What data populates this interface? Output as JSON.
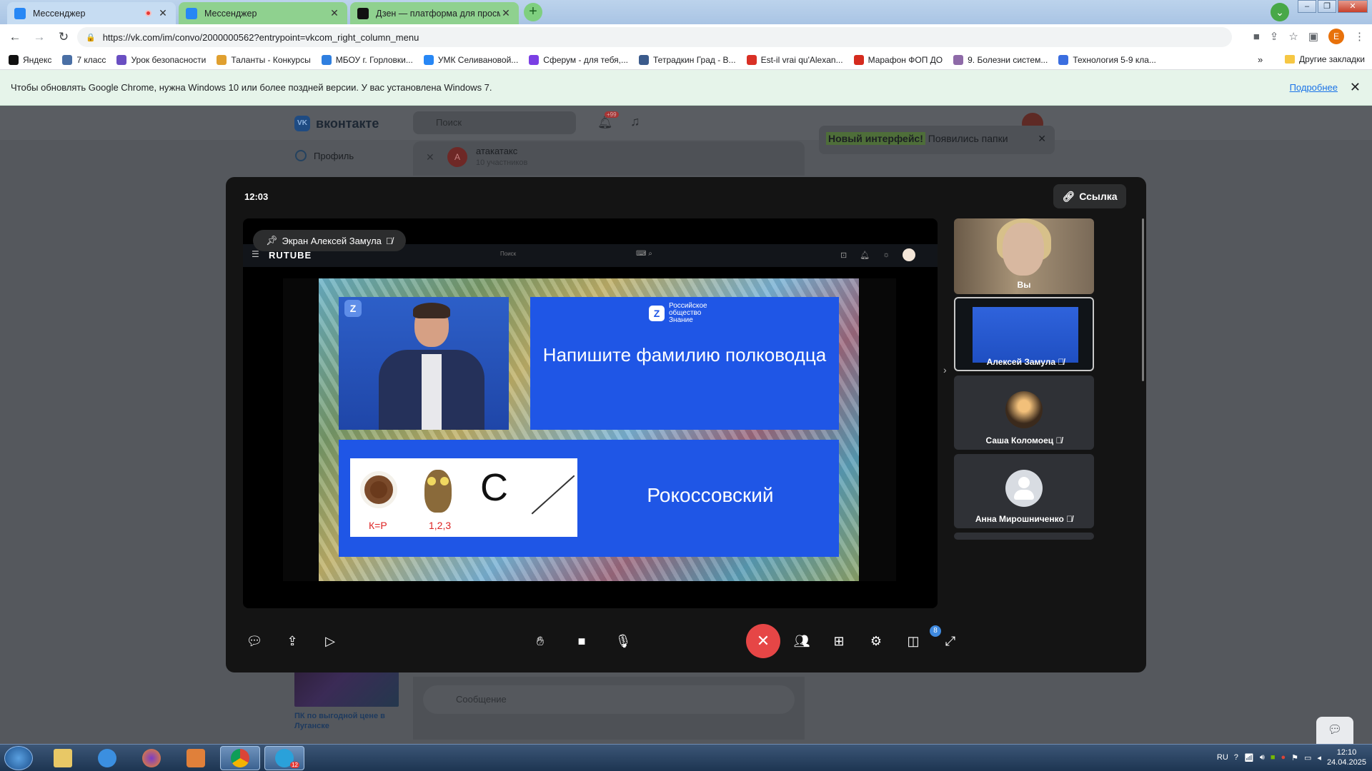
{
  "browser": {
    "tabs": [
      {
        "title": "Мессенджер",
        "recording": true,
        "favicon_color": "#2787f5"
      },
      {
        "title": "Мессенджер",
        "recording": false,
        "favicon_color": "#2787f5"
      },
      {
        "title": "Дзен — платформа для просмо",
        "recording": false,
        "favicon_color": "#111111"
      }
    ],
    "url": "https://vk.com/im/convo/2000000562?entrypoint=vkcom_right_column_menu",
    "profile_letter": "E",
    "bookmarks": [
      {
        "label": "Яндекс",
        "color": "#111111"
      },
      {
        "label": "7 класс",
        "color": "#4a6fa5"
      },
      {
        "label": "Урок безопасности",
        "color": "#6a4fc2"
      },
      {
        "label": "Таланты - Конкурсы",
        "color": "#e0a030"
      },
      {
        "label": "МБОУ г. Горловки...",
        "color": "#2f7fe0"
      },
      {
        "label": "УМК Селивановой...",
        "color": "#2787f5"
      },
      {
        "label": "Сферум - для тебя,...",
        "color": "#7b3fe4"
      },
      {
        "label": "Тетрадкин Град - В...",
        "color": "#3b5b8c"
      },
      {
        "label": "Est-il vrai qu'Alexan...",
        "color": "#d93025"
      },
      {
        "label": "Марафон ФОП ДО",
        "color": "#d52b1e"
      },
      {
        "label": "9. Болезни систем...",
        "color": "#8e6aa8"
      },
      {
        "label": "Технология 5-9 кла...",
        "color": "#3b6ee0"
      }
    ],
    "bookmarks_more": "»",
    "other_bookmarks": "Другие закладки",
    "infobar": {
      "message": "Чтобы обновлять Google Chrome, нужна Windows 10 или более поздней версии. У вас установлена Windows 7.",
      "link": "Подробнее",
      "close": "✕"
    }
  },
  "vk": {
    "logo": "вконтакте",
    "search_placeholder": "Поиск",
    "notif_badge": "+99",
    "sidebar_profile": "Профиль",
    "chat_name": "атакатакс",
    "chat_members": "10 участников",
    "chat_avatar_letter": "А",
    "notice_highlight": "Новый интерфейс!",
    "notice_rest": " Появились папки",
    "message_placeholder": "Сообщение",
    "ad_text": "ПК по выгодной цене в Луганске"
  },
  "call": {
    "time": "12:03",
    "link_label": "Ссылка",
    "pinned_label": "Экран Алексей Замула",
    "rutube": {
      "logo": "RUTUBE",
      "search": "Поиск",
      "org_line1": "Российское",
      "org_line2": "общество",
      "org_line3": "Знание",
      "question": "Напишите фамилию полководца",
      "rebus_k": "К=Р",
      "rebus_n": "1,2,3",
      "rebus_letter": "С",
      "answer": "Рокоссовский"
    },
    "participants": [
      {
        "name": "Вы",
        "type": "camera"
      },
      {
        "name": "Алексей Замула",
        "type": "screen"
      },
      {
        "name": "Саша Коломоец",
        "type": "avatar"
      },
      {
        "name": "Анна Мирошниченко",
        "type": "placeholder"
      }
    ],
    "participants_count": "8",
    "controls": [
      "chat",
      "share-screen",
      "effects",
      "raise-hand",
      "camera",
      "microphone",
      "hang-up",
      "participants",
      "grid-view",
      "settings",
      "layout",
      "fullscreen"
    ]
  },
  "taskbar": {
    "lang": "RU",
    "time": "12:10",
    "date": "24.04.2025",
    "telegram_badge": "12"
  }
}
